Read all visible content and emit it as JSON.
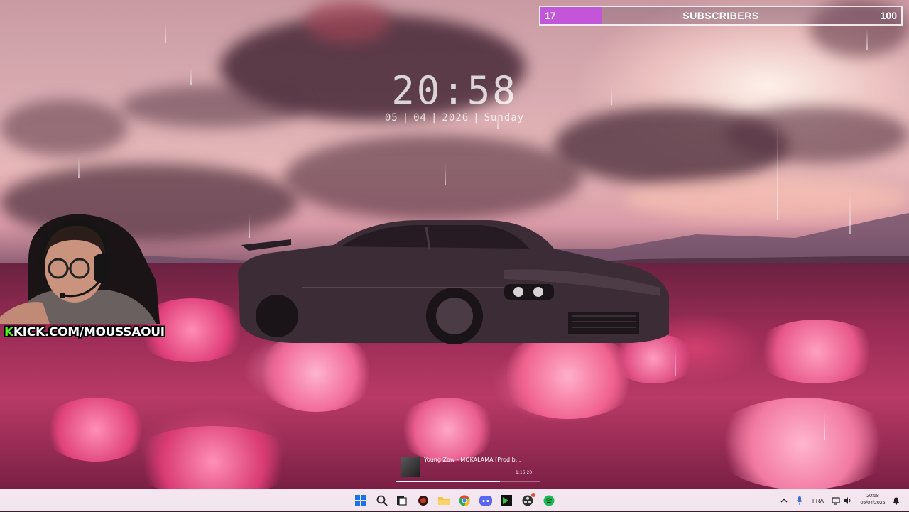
{
  "clock": {
    "time": "20:58",
    "day": "05",
    "month": "04",
    "year": "2026",
    "weekday": "Sunday",
    "separator": "|"
  },
  "subscriber_goal": {
    "current": "17",
    "label": "SUBSCRIBERS",
    "target": "100",
    "progress_fraction": 0.17,
    "fill_color": "#c255d8"
  },
  "webcam": {
    "kick_prefix": "K",
    "kick_text": "KICK.COM/MOUSSAOUI",
    "kick_color": "#53fc18"
  },
  "now_playing": {
    "title": "Young Zow - MOKALAMA [Prod.b...",
    "time": "1:16:20",
    "progress_fraction": 0.72
  },
  "taskbar": {
    "icons": [
      {
        "name": "windows-start-icon",
        "color": "#1a73e8"
      },
      {
        "name": "search-icon",
        "color": "#222222"
      },
      {
        "name": "task-view-icon",
        "color": "#222222"
      },
      {
        "name": "app-red-circle-icon",
        "color": "#c0392b"
      },
      {
        "name": "file-explorer-icon",
        "color": "#f4c542"
      },
      {
        "name": "chrome-icon",
        "color": "#34a853"
      },
      {
        "name": "discord-icon",
        "color": "#5865f2"
      },
      {
        "name": "terminal-green-icon",
        "color": "#2ecc40"
      },
      {
        "name": "obs-icon",
        "color": "#303030"
      },
      {
        "name": "spotify-icon",
        "color": "#1db954"
      }
    ],
    "language": "FRA",
    "time": "20:58",
    "date": "05/04/2026"
  }
}
